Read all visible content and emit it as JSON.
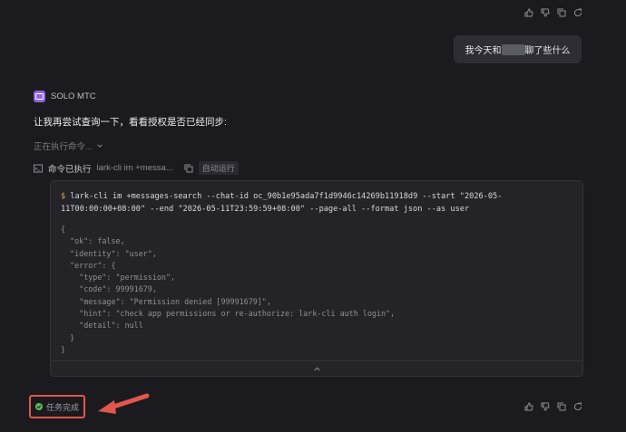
{
  "user_message": {
    "text_before": "我今天和",
    "text_after": "聊了些什么"
  },
  "agent": {
    "name": "SOLO MTC",
    "message": "让我再尝试查询一下，看看授权是否已经同步:",
    "executing": "正在执行命令..."
  },
  "command": {
    "status_label": "命令已执行",
    "preview": "lark-cli im +messa...",
    "auto_run_badge": "自动运行",
    "prompt": "$",
    "full_text": "lark-cli im +messages-search --chat-id oc_90b1e95ada7f1d9946c14269b11918d9 --start \"2026-05-11T00:00:00+08:00\" --end \"2026-05-11T23:59:59+08:00\" --page-all --format json --as user",
    "output_lines": [
      "{",
      "  \"ok\": false,",
      "  \"identity\": \"user\",",
      "  \"error\": {",
      "    \"type\": \"permission\",",
      "    \"code\": 99991679,",
      "    \"message\": \"Permission denied [99991679]\",",
      "    \"hint\": \"check app permissions or re-authorize: lark-cli auth login\",",
      "    \"detail\": null",
      "  }",
      "}"
    ]
  },
  "task": {
    "status_label": "任务完成"
  },
  "colors": {
    "background": "#1b1b1f",
    "agent_logo": "#8e63df",
    "highlight": "#e2564d",
    "success": "#5fb85c"
  },
  "icons": [
    "thumbs-up-icon",
    "thumbs-down-icon",
    "copy-icon",
    "refresh-icon",
    "terminal-icon",
    "chevron-down-icon",
    "chevron-up-icon",
    "check-circle-icon",
    "arrow-icon"
  ]
}
